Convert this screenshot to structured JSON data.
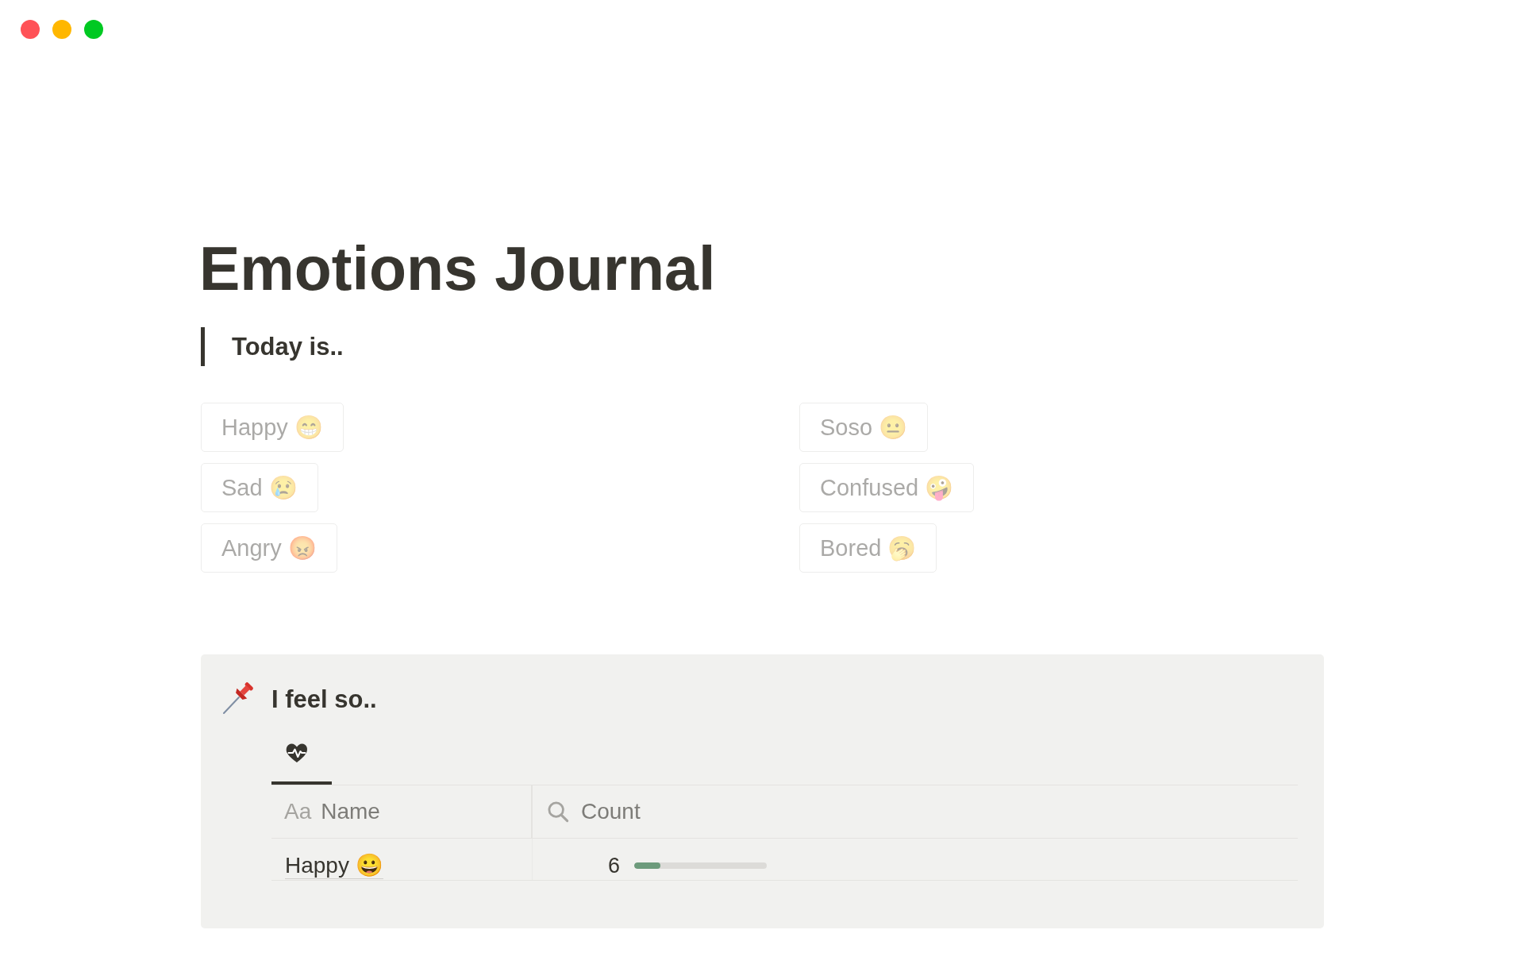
{
  "page": {
    "title": "Emotions Journal",
    "quote": "Today is.."
  },
  "button_columns": [
    {
      "buttons": [
        {
          "label": "Happy 😁"
        },
        {
          "label": "Sad 😢"
        },
        {
          "label": "Angry 😡"
        }
      ]
    },
    {
      "buttons": [
        {
          "label": "Soso 😐"
        },
        {
          "label": "Confused 🤪"
        },
        {
          "label": "Bored 🥱"
        }
      ]
    }
  ],
  "callout": {
    "title": "I feel so..",
    "view_tabs": [
      {
        "selected": true
      }
    ],
    "table": {
      "columns": [
        {
          "kind": "title",
          "type_glyph": "Aa",
          "label": "Name"
        },
        {
          "kind": "rollup",
          "label": "Count"
        }
      ],
      "rows": [
        {
          "name": "Happy 😀",
          "count": "6",
          "level": 0.2
        }
      ]
    }
  }
}
